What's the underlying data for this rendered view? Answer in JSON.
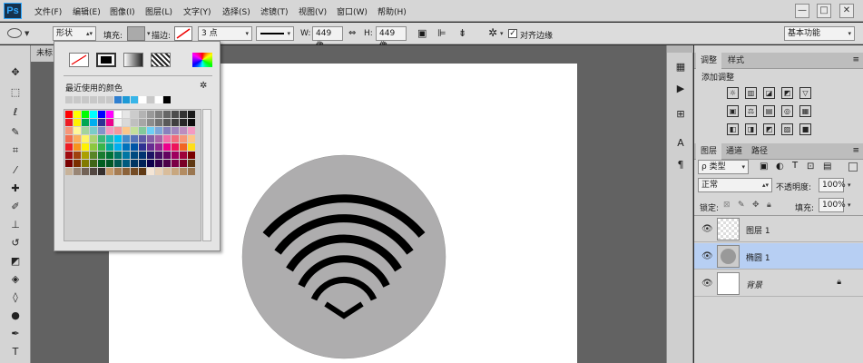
{
  "app": {
    "logo": "Ps"
  },
  "menu": [
    "文件(F)",
    "编辑(E)",
    "图像(I)",
    "图层(L)",
    "文字(Y)",
    "选择(S)",
    "滤镜(T)",
    "视图(V)",
    "窗口(W)",
    "帮助(H)"
  ],
  "window_controls": {
    "minimize": "—",
    "maximize": "□",
    "close": "✕"
  },
  "options": {
    "shape_mode": "形状",
    "fill_label": "填充:",
    "stroke_label": "描边:",
    "stroke_width": "3 点",
    "w_label": "W:",
    "w_value": "449 像",
    "h_label": "H:",
    "h_value": "449 像",
    "align_edges": "对齐边缘",
    "workspace": "基本功能"
  },
  "document": {
    "tab_title": "未标"
  },
  "swatch_popup": {
    "recent_label": "最近使用的颜色",
    "recent_colors": [
      "#c8c8c8",
      "#c8c8c8",
      "#c8c8c8",
      "#c8c8c8",
      "#c8c8c8",
      "#c8c8c8",
      "#2f7fd0",
      "#1e9ad6",
      "#38b5e8",
      "#ffffff",
      "#c8c8c8",
      "#ffffff",
      "#000000"
    ],
    "palette_rows": [
      [
        "#ff0000",
        "#ffff00",
        "#00ff00",
        "#00ffff",
        "#0000ff",
        "#ff00ff",
        "#ffffff",
        "#e6e6e6",
        "#cccccc",
        "#b3b3b3",
        "#999999",
        "#808080",
        "#666666",
        "#4d4d4d",
        "#333333",
        "#1a1a1a"
      ],
      [
        "#ed1c24",
        "#fff200",
        "#00a651",
        "#00aeef",
        "#2e3192",
        "#ec008c",
        "#f2f2f2",
        "#d9d9d9",
        "#bfbfbf",
        "#a6a6a6",
        "#8c8c8c",
        "#737373",
        "#595959",
        "#404040",
        "#262626",
        "#0d0d0d"
      ],
      [
        "#f69679",
        "#fff799",
        "#a3d39c",
        "#7accc8",
        "#8393ca",
        "#f49ac1",
        "#f5989d",
        "#fdc68a",
        "#c4df9b",
        "#82ca9c",
        "#6dcff6",
        "#7da7d9",
        "#8781bd",
        "#a187be",
        "#bd8cbf",
        "#f49ac2"
      ],
      [
        "#f26c4f",
        "#fbaf5d",
        "#fff467",
        "#acd373",
        "#3cb878",
        "#1cbbb4",
        "#00bff3",
        "#448ccb",
        "#5674b9",
        "#605ca8",
        "#855fa8",
        "#a864a8",
        "#f06ea9",
        "#f26d7d",
        "#f7977a",
        "#fdc689"
      ],
      [
        "#ed1c24",
        "#f7941d",
        "#fff200",
        "#8dc73f",
        "#39b54a",
        "#00a99d",
        "#00aeef",
        "#0072bc",
        "#0054a6",
        "#2e3192",
        "#662d91",
        "#92278f",
        "#ec008c",
        "#ed145b",
        "#f26522",
        "#ffde17"
      ],
      [
        "#9e0b0f",
        "#a0410d",
        "#aba000",
        "#598527",
        "#197b30",
        "#007236",
        "#00746b",
        "#0076a3",
        "#004a80",
        "#003471",
        "#1b1464",
        "#440e62",
        "#630460",
        "#9e005d",
        "#9e0039",
        "#790000"
      ],
      [
        "#790000",
        "#7b2e00",
        "#827b00",
        "#406618",
        "#005e20",
        "#005826",
        "#005952",
        "#005b7f",
        "#003663",
        "#002157",
        "#0d004c",
        "#32004b",
        "#4b0049",
        "#7b0046",
        "#7a0026",
        "#603913"
      ],
      [
        "#c7b299",
        "#998675",
        "#736357",
        "#534741",
        "#362f2d",
        "#c69c6d",
        "#a67c52",
        "#8c6239",
        "#754c24",
        "#603913",
        "#f4e5d5",
        "#e8d2b8",
        "#d9bd9b",
        "#c8a77f",
        "#b38c62",
        "#9a7650"
      ]
    ]
  },
  "panels": {
    "adjust_tabs": [
      "调整",
      "样式"
    ],
    "adjust_title": "添加调整",
    "adjust_icons_row1": [
      "☼",
      "▥",
      "◪",
      "◩",
      "▽"
    ],
    "adjust_icons_row2": [
      "▣",
      "⚖",
      "▤",
      "◎",
      "▦"
    ],
    "adjust_icons_row3": [
      "◧",
      "◨",
      "◩",
      "▨",
      "■"
    ],
    "layer_tabs": [
      "图层",
      "通道",
      "路径"
    ],
    "filter_kind": "ρ 类型",
    "blend_mode": "正常",
    "opacity_label": "不透明度:",
    "opacity_value": "100%",
    "lock_label": "锁定:",
    "fill_label": "填充:",
    "fill_value": "100%",
    "layers": [
      {
        "name": "图层 1",
        "selected": false,
        "thumb": "transparent"
      },
      {
        "name": "椭圆 1",
        "selected": true,
        "thumb": "shape"
      },
      {
        "name": "背景",
        "selected": false,
        "thumb": "white",
        "locked": true
      }
    ]
  },
  "colors": {
    "ui_gray": "#d6d6d6",
    "canvas_bg": "#ffffff",
    "circle_fill": "#aeadae",
    "wifi_black": "#000000",
    "selected_layer": "#b7cff3"
  }
}
